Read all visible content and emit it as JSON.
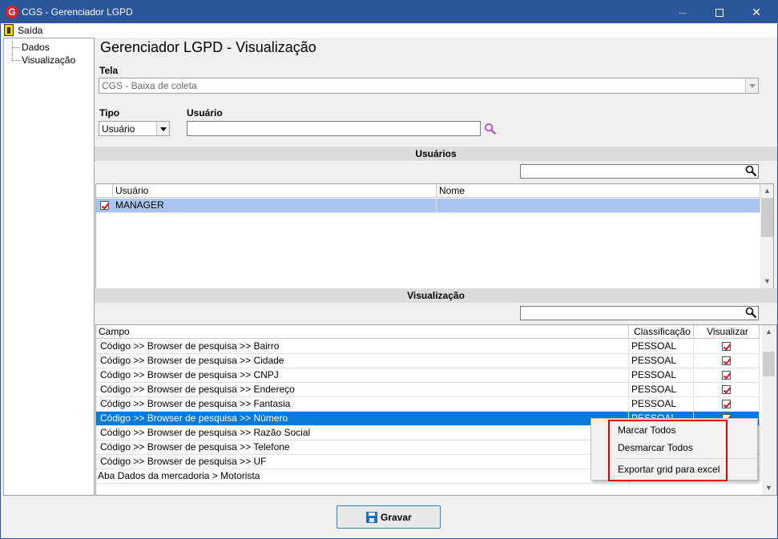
{
  "window": {
    "title": "CGS - Gerenciador LGPD",
    "app_icon": "G"
  },
  "menu": {
    "exit_label": "Saída"
  },
  "tree": {
    "items": [
      "Dados",
      "Visualização"
    ]
  },
  "page": {
    "title": "Gerenciador LGPD - Visualização"
  },
  "tela": {
    "label": "Tela",
    "value": "CGS - Baixa de coleta"
  },
  "tipo": {
    "label": "Tipo",
    "value": "Usuário"
  },
  "usuario": {
    "label": "Usuário",
    "value": ""
  },
  "usuarios_section": {
    "header": "Usuários",
    "search_value": "",
    "columns": [
      "Usuário",
      "Nome"
    ],
    "rows": [
      {
        "checked": true,
        "usuario": "MANAGER",
        "nome": ""
      }
    ]
  },
  "visualizacao_section": {
    "header": "Visualização",
    "search_value": "",
    "columns": [
      "Campo",
      "Classificação",
      "Visualizar"
    ],
    "rows": [
      {
        "campo": "Código >> Browser de pesquisa >> Bairro",
        "classificacao": "PESSOAL",
        "visualizar": true
      },
      {
        "campo": "Código >> Browser de pesquisa >> Cidade",
        "classificacao": "PESSOAL",
        "visualizar": true
      },
      {
        "campo": "Código >> Browser de pesquisa >> CNPJ",
        "classificacao": "PESSOAL",
        "visualizar": true
      },
      {
        "campo": "Código >> Browser de pesquisa >> Endereço",
        "classificacao": "PESSOAL",
        "visualizar": true
      },
      {
        "campo": "Código >> Browser de pesquisa >> Fantasia",
        "classificacao": "PESSOAL",
        "visualizar": true
      },
      {
        "campo": "Código >> Browser de pesquisa >> Número",
        "classificacao": "PESSOAL",
        "visualizar": true,
        "selected": true
      },
      {
        "campo": "Código >> Browser de pesquisa >> Razão Social",
        "classificacao": "",
        "visualizar": null
      },
      {
        "campo": "Código >> Browser de pesquisa >> Telefone",
        "classificacao": "",
        "visualizar": null
      },
      {
        "campo": "Código >> Browser de pesquisa >> UF",
        "classificacao": "",
        "visualizar": null
      },
      {
        "campo": "Aba Dados da mercadoria > Motorista",
        "classificacao": "",
        "visualizar": null
      }
    ]
  },
  "context_menu": {
    "items": [
      "Marcar Todos",
      "Desmarcar Todos",
      "Exportar grid para excel"
    ]
  },
  "save_button": {
    "label": "Gravar",
    "icon": "floppy-disk-icon"
  },
  "colors": {
    "titlebar": "#2b579a",
    "selected_row_users": "#a9c4ef",
    "selected_row_fields": "#0a7ad8",
    "highlight_box": "#e00000",
    "checkbox_mark": "#d8112a"
  }
}
